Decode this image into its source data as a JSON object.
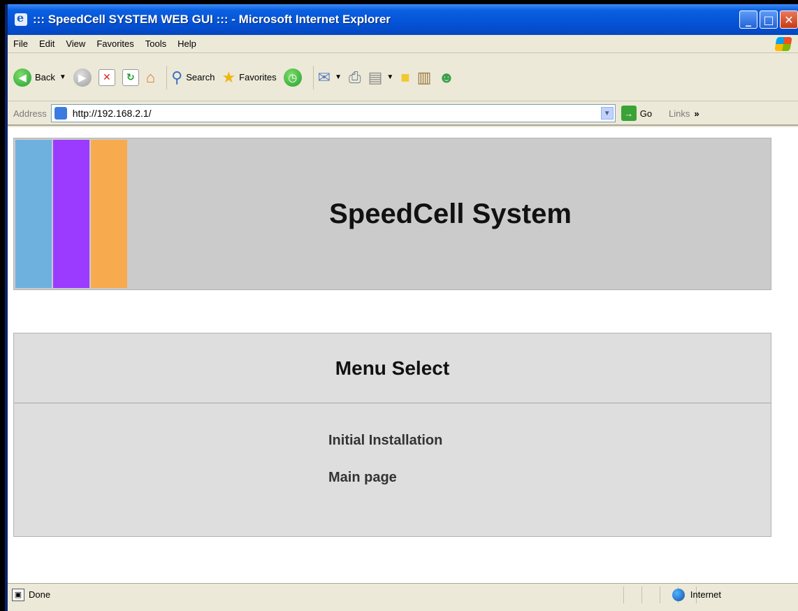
{
  "window": {
    "title": "::: SpeedCell SYSTEM WEB GUI ::: - Microsoft Internet Explorer"
  },
  "menubar": {
    "items": [
      "File",
      "Edit",
      "View",
      "Favorites",
      "Tools",
      "Help"
    ]
  },
  "toolbar": {
    "back_label": "Back",
    "search_label": "Search",
    "favorites_label": "Favorites"
  },
  "address": {
    "label": "Address",
    "url": "http://192.168.2.1/",
    "go_label": "Go",
    "links_label": "Links"
  },
  "page": {
    "banner_title": "SpeedCell System",
    "strip_colors": [
      "#6fb1de",
      "#9b3bff",
      "#f8ab4e"
    ],
    "menu_title": "Menu Select",
    "menu_items": [
      "Initial Installation",
      "Main page"
    ]
  },
  "status": {
    "text": "Done",
    "zone": "Internet"
  }
}
